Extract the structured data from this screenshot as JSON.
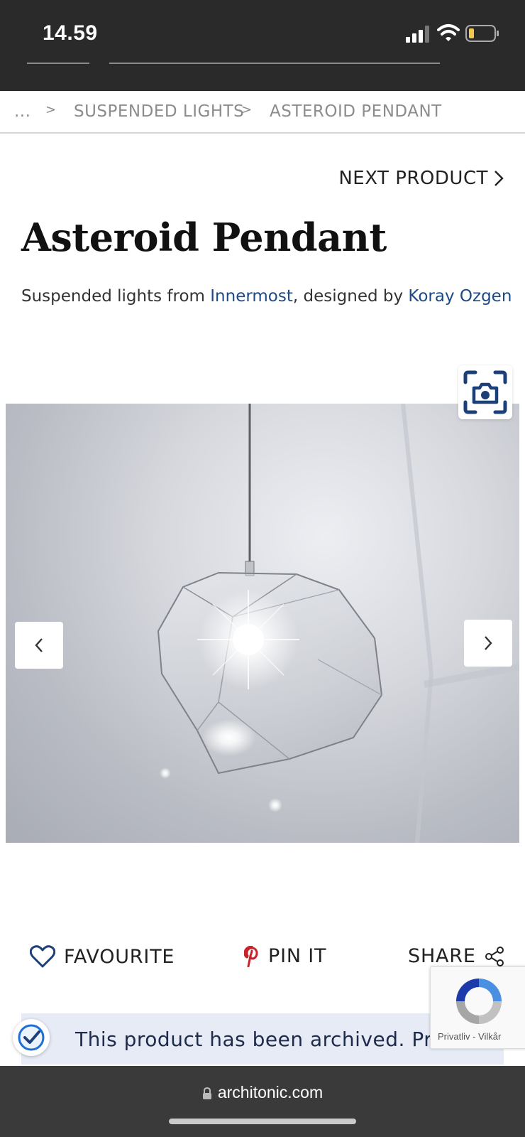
{
  "status_bar": {
    "time": "14.59"
  },
  "breadcrumb": {
    "items": [
      "...",
      "SUSPENDED LIGHTS",
      "ASTEROID PENDANT"
    ],
    "separator": ">"
  },
  "product": {
    "next_label": "NEXT PRODUCT",
    "title": "Asteroid Pendant",
    "subtitle_prefix": "Suspended lights from ",
    "brand": "Innermost",
    "subtitle_middle": ", designed by ",
    "designer": "Koray Ozgen"
  },
  "actions": {
    "favourite": "FAVOURITE",
    "pin": "PIN IT",
    "share": "SHARE"
  },
  "banner": {
    "text": "This product has been archived. Product"
  },
  "recaptcha": {
    "text": "Privatliv - Vilkår"
  },
  "browser": {
    "url": "architonic.com"
  },
  "colors": {
    "link": "#1d4a86",
    "pinterest": "#c8232c",
    "heart": "#1d3f78"
  }
}
